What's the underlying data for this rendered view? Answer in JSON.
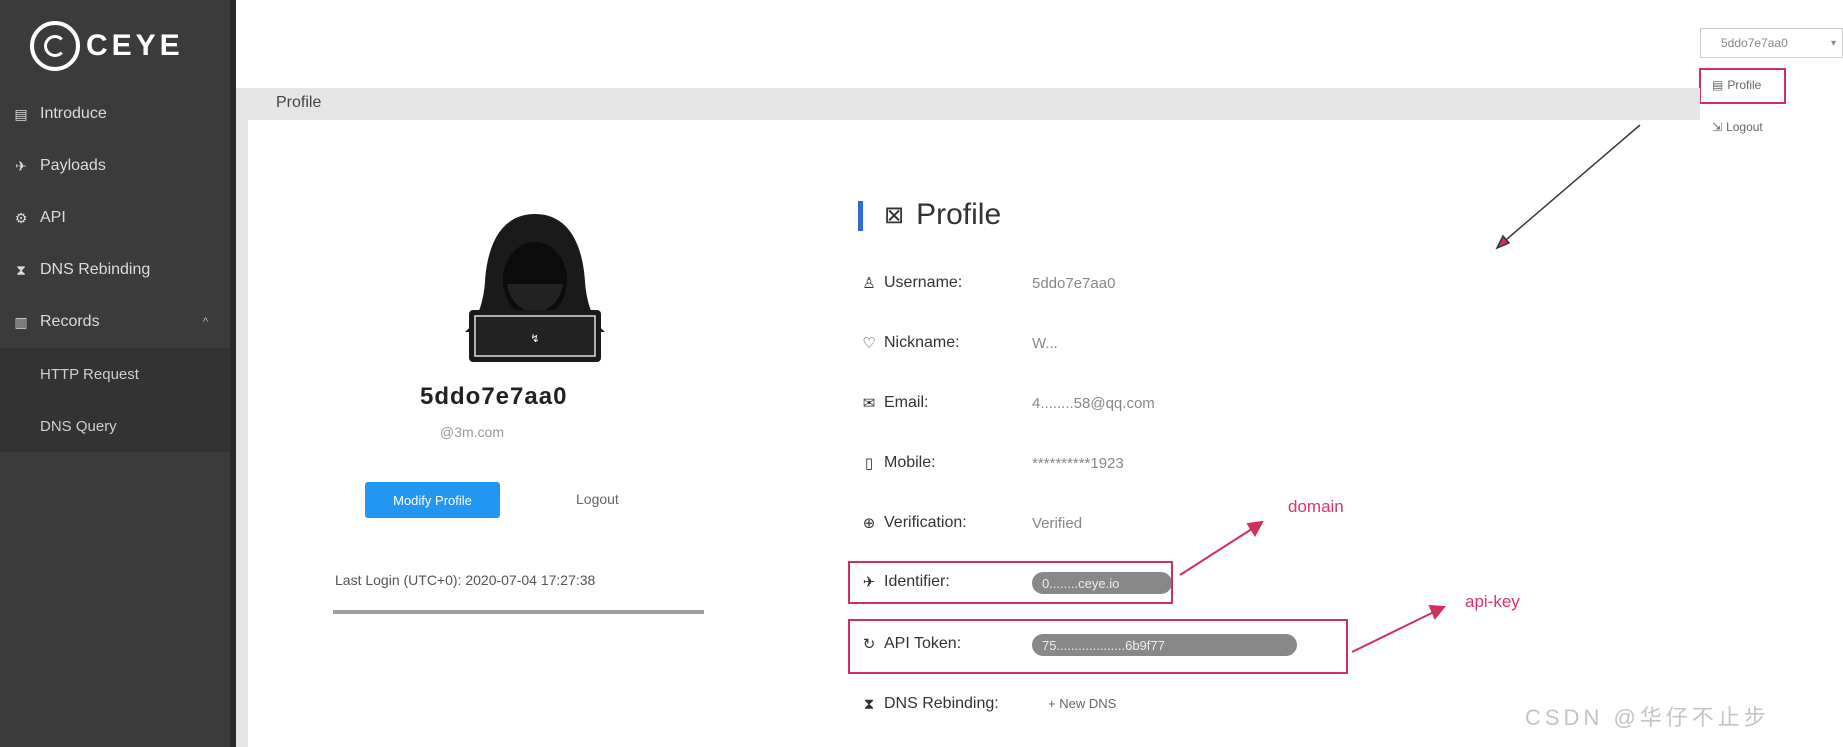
{
  "app": {
    "logo_text": "CEYE"
  },
  "sidebar": {
    "items": [
      {
        "icon": "document-icon",
        "glyph": "▤",
        "label": "Introduce"
      },
      {
        "icon": "rocket-icon",
        "glyph": "✈",
        "label": "Payloads"
      },
      {
        "icon": "api-icon",
        "glyph": "⚙",
        "label": "API"
      },
      {
        "icon": "hourglass-icon",
        "glyph": "⧗",
        "label": "DNS Rebinding"
      },
      {
        "icon": "records-icon",
        "glyph": "▥",
        "label": "Records"
      }
    ],
    "subitems": [
      "HTTP Request",
      "DNS Query"
    ]
  },
  "topbar": {
    "user_dropdown": "5ddo7e7aa0",
    "menu_profile": "Profile",
    "menu_logout": "Logout"
  },
  "breadcrumb": "Profile",
  "profile_card": {
    "name": "5ddo7e7aa0",
    "email": "@3m.com",
    "modify_button": "Modify Profile",
    "logout_button": "Logout",
    "last_login": "Last Login (UTC+0): 2020-07-04 17:27:38"
  },
  "details": {
    "title": "Profile",
    "fields": [
      {
        "icon": "user-icon",
        "glyph": "♙",
        "label": "Username:",
        "value": "5ddo7e7aa0"
      },
      {
        "icon": "heart-icon",
        "glyph": "♡",
        "label": "Nickname:",
        "value": "W..."
      },
      {
        "icon": "mail-icon",
        "glyph": "✉",
        "label": "Email:",
        "value": "4........58@qq.com"
      },
      {
        "icon": "mobile-icon",
        "glyph": "▯",
        "label": "Mobile:",
        "value": "**********1923"
      },
      {
        "icon": "lock-icon",
        "glyph": "⊕",
        "label": "Verification:",
        "value": "Verified"
      },
      {
        "icon": "rocket-icon",
        "glyph": "✈",
        "label": "Identifier:",
        "value": "0........ceye.io"
      },
      {
        "icon": "token-icon",
        "glyph": "↻",
        "label": "API Token:",
        "value": "75...................6b9f77"
      },
      {
        "icon": "hourglass-icon",
        "glyph": "⧗",
        "label": "DNS Rebinding:",
        "value": "+ New DNS"
      }
    ]
  },
  "annotations": {
    "domain": "domain",
    "api_key": "api-key",
    "watermark": "CSDN @华仔不止步"
  },
  "colors": {
    "sidebar": "#3b3b3b",
    "primary_button": "#2196f3",
    "annotation": "#d0305a"
  }
}
